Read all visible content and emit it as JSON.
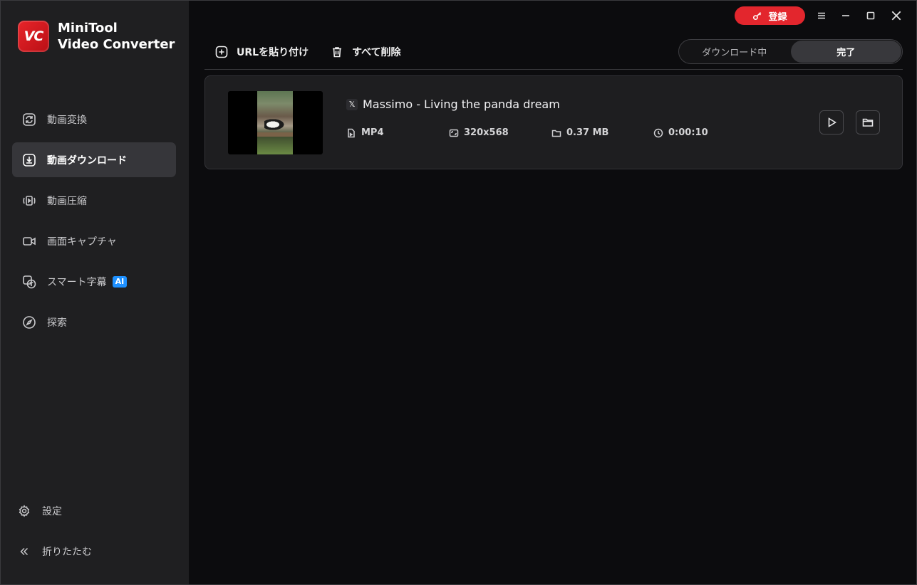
{
  "app": {
    "logo_mark": "VC",
    "name_line1": "MiniTool",
    "name_line2": "Video Converter"
  },
  "titlebar": {
    "register_label": "登録"
  },
  "sidebar": {
    "items": [
      {
        "label": "動画変換",
        "icon": "refresh-icon"
      },
      {
        "label": "動画ダウンロード",
        "icon": "download-icon",
        "active": true
      },
      {
        "label": "動画圧縮",
        "icon": "compress-icon"
      },
      {
        "label": "画面キャプチャ",
        "icon": "camera-icon"
      },
      {
        "label": "スマート字幕",
        "icon": "subtitle-icon",
        "badge": "AI"
      },
      {
        "label": "探索",
        "icon": "compass-icon"
      }
    ],
    "settings_label": "設定",
    "collapse_label": "折りたたむ"
  },
  "toolbar": {
    "paste_url_label": "URLを貼り付け",
    "delete_all_label": "すべて削除"
  },
  "tabs": {
    "downloading": "ダウンロード中",
    "completed": "完了",
    "active": "completed"
  },
  "downloads": [
    {
      "source_icon": "x-icon",
      "source_glyph": "𝕏",
      "title": "Massimo - Living the panda dream",
      "format": "MP4",
      "resolution": "320x568",
      "size": "0.37 MB",
      "duration": "0:00:10"
    }
  ],
  "colors": {
    "accent_red": "#e3262d",
    "sidebar_bg": "#1f1f21",
    "main_bg": "#0c0c0e",
    "ai_badge": "#1e90ff"
  }
}
